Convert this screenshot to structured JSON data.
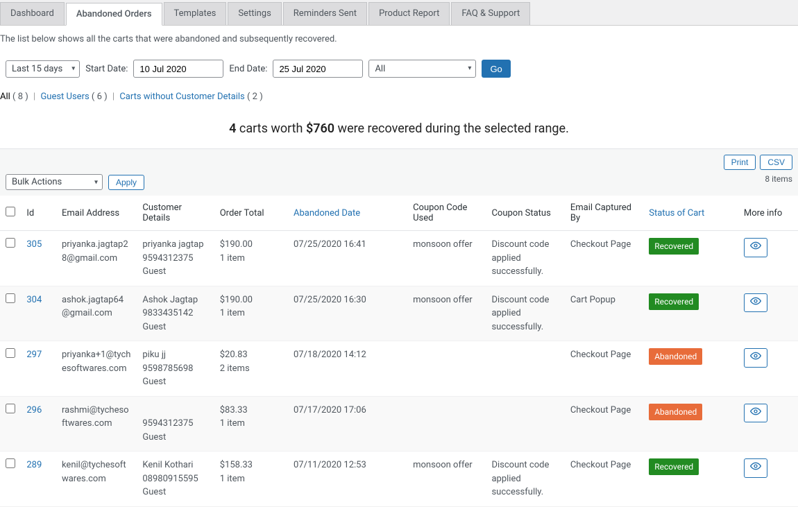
{
  "tabs": [
    {
      "label": "Dashboard",
      "active": false
    },
    {
      "label": "Abandoned Orders",
      "active": true
    },
    {
      "label": "Templates",
      "active": false
    },
    {
      "label": "Settings",
      "active": false
    },
    {
      "label": "Reminders Sent",
      "active": false
    },
    {
      "label": "Product Report",
      "active": false
    },
    {
      "label": "FAQ & Support",
      "active": false
    }
  ],
  "description": "The list below shows all the carts that were abandoned and subsequently recovered.",
  "filters": {
    "range_select": "Last 15 days",
    "start_label": "Start Date:",
    "start_value": "10 Jul 2020",
    "end_label": "End Date:",
    "end_value": "25 Jul 2020",
    "status_select": "All",
    "go_label": "Go"
  },
  "subfilters": {
    "all_label": "All",
    "all_count": "( 8 )",
    "guest_label": "Guest Users",
    "guest_count": "( 6 )",
    "no_details_label": "Carts without Customer Details",
    "no_details_count": "( 2 )"
  },
  "summary": {
    "carts": "4",
    "mid1": " carts worth ",
    "amount": "$760",
    "mid2": " were recovered during the selected range."
  },
  "toolbar": {
    "bulk_label": "Bulk Actions",
    "apply_label": "Apply",
    "print_label": "Print",
    "csv_label": "CSV",
    "item_count": "8 items"
  },
  "columns": {
    "id": "Id",
    "email": "Email Address",
    "cust": "Customer Details",
    "total": "Order Total",
    "date": "Abandoned Date",
    "coupon": "Coupon Code Used",
    "cstatus": "Coupon Status",
    "cap": "Email Captured By",
    "status": "Status of Cart",
    "more": "More info"
  },
  "rows": [
    {
      "id": "305",
      "email": "priyanka.jagtap28@gmail.com",
      "cust": "priyanka jagtap\n9594312375\nGuest",
      "total": "$190.00\n1 item",
      "date": "07/25/2020 16:41",
      "coupon": "monsoon offer",
      "cstatus": "Discount code applied successfully.",
      "cap": "Checkout Page",
      "status": "Recovered",
      "status_class": "recovered"
    },
    {
      "id": "304",
      "email": "ashok.jagtap64@gmail.com",
      "cust": "Ashok Jagtap\n9833435142\nGuest",
      "total": "$190.00\n1 item",
      "date": "07/25/2020 16:30",
      "coupon": "monsoon offer",
      "cstatus": "Discount code applied successfully.",
      "cap": "Cart Popup",
      "status": "Recovered",
      "status_class": "recovered"
    },
    {
      "id": "297",
      "email": "priyanka+1@tychesoftwares.com",
      "cust": "piku jj\n9598785698\nGuest",
      "total": "$20.83\n2 items",
      "date": "07/18/2020 14:12",
      "coupon": "",
      "cstatus": "",
      "cap": "Checkout Page",
      "status": "Abandoned",
      "status_class": "abandoned"
    },
    {
      "id": "296",
      "email": "rashmi@tychesoftwares.com",
      "cust": "\n9594312375\nGuest",
      "total": "$83.33\n1 item",
      "date": "07/17/2020 17:06",
      "coupon": "",
      "cstatus": "",
      "cap": "Checkout Page",
      "status": "Abandoned",
      "status_class": "abandoned"
    },
    {
      "id": "289",
      "email": "kenil@tychesoftwares.com",
      "cust": "Kenil Kothari\n08980915595\nGuest",
      "total": "$158.33\n1 item",
      "date": "07/11/2020 12:53",
      "coupon": "monsoon offer",
      "cstatus": "Discount code applied successfully.",
      "cap": "Checkout Page",
      "status": "Recovered",
      "status_class": "recovered"
    }
  ]
}
